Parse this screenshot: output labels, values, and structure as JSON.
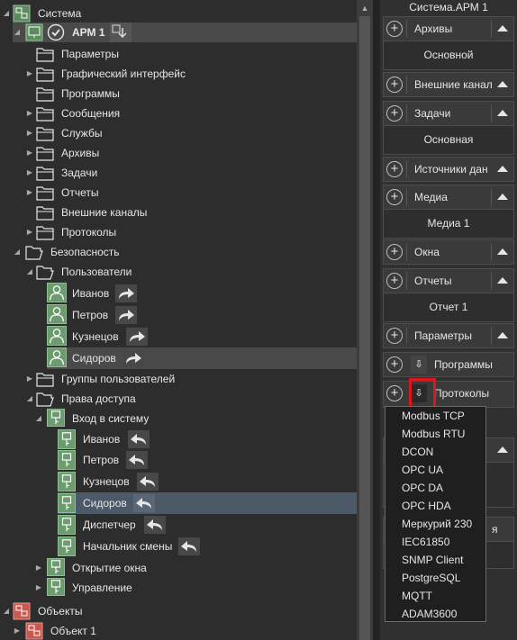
{
  "tree": {
    "root": "Система",
    "arm": "АРМ 1",
    "arm_children": [
      "Параметры",
      "Графический интерфейс",
      "Программы",
      "Сообщения",
      "Службы",
      "Архивы",
      "Задачи",
      "Отчеты",
      "Внешние каналы",
      "Протоколы"
    ],
    "security": "Безопасность",
    "users_folder": "Пользователи",
    "users": [
      "Иванов",
      "Петров",
      "Кузнецов",
      "Сидоров"
    ],
    "user_groups": "Группы пользователей",
    "access_rights": "Права доступа",
    "login": "Вход в систему",
    "login_users": [
      "Иванов",
      "Петров",
      "Кузнецов",
      "Сидоров",
      "Диспетчер",
      "Начальник смены"
    ],
    "open_window": "Открытие окна",
    "control": "Управление",
    "objects": "Объекты",
    "object1": "Объект 1"
  },
  "panel": {
    "title": "Система.АРМ 1",
    "sections": [
      {
        "label": "Архивы",
        "sub": "Основной"
      },
      {
        "label": "Внешние канал",
        "sub": null
      },
      {
        "label": "Задачи",
        "sub": "Основная"
      },
      {
        "label": "Источники дан",
        "sub": null
      },
      {
        "label": "Медиа",
        "sub": "Медиа 1"
      },
      {
        "label": "Окна",
        "sub": null
      },
      {
        "label": "Отчеты",
        "sub": "Отчет 1"
      },
      {
        "label": "Параметры",
        "sub": null
      },
      {
        "label": "Программы",
        "sub": null
      },
      {
        "label": "Протоколы",
        "sub": null
      }
    ],
    "partial_bottom_label": "я"
  },
  "dropdown": {
    "options": [
      "Modbus TCP",
      "Modbus RTU",
      "DCON",
      "OPC UA",
      "OPC DA",
      "OPC HDA",
      "Меркурий 230",
      "IEC61850",
      "SNMP Client",
      "PostgreSQL",
      "MQTT",
      "ADAM3600"
    ]
  },
  "colors": {
    "highlight": "#e0141b",
    "selected_row": "#4c5968",
    "icon_green": "#6b9b6e",
    "object_red": "#d9534f"
  }
}
